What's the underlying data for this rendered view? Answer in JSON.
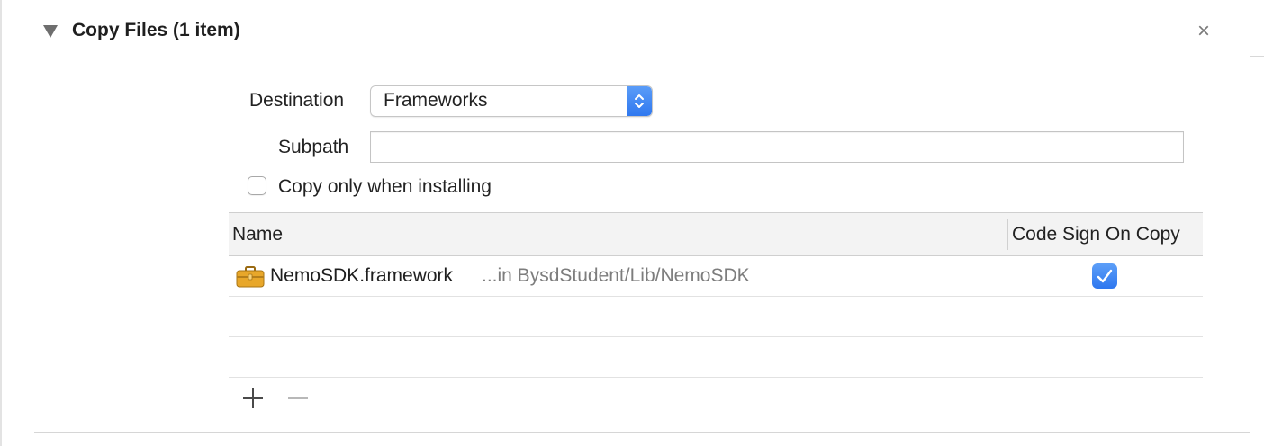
{
  "phase": {
    "title": "Copy Files (1 item)",
    "close_glyph": "×"
  },
  "form": {
    "destination_label": "Destination",
    "destination_value": "Frameworks",
    "subpath_label": "Subpath",
    "subpath_value": "",
    "copy_only_label": "Copy only when installing",
    "copy_only_checked": false
  },
  "table": {
    "columns": [
      "Name",
      "Code Sign On Copy"
    ],
    "rows": [
      {
        "icon": "framework-briefcase-icon",
        "name": "NemoSDK.framework",
        "path": "...in BysdStudent/Lib/NemoSDK",
        "code_sign_on_copy": true
      }
    ]
  },
  "toolbar": {
    "add_glyph": "+",
    "remove_glyph": "−"
  },
  "colors": {
    "accent_blue": "#2f78ef",
    "secondary_text": "#7d7d7d",
    "icon_gold": "#e8a72a"
  }
}
